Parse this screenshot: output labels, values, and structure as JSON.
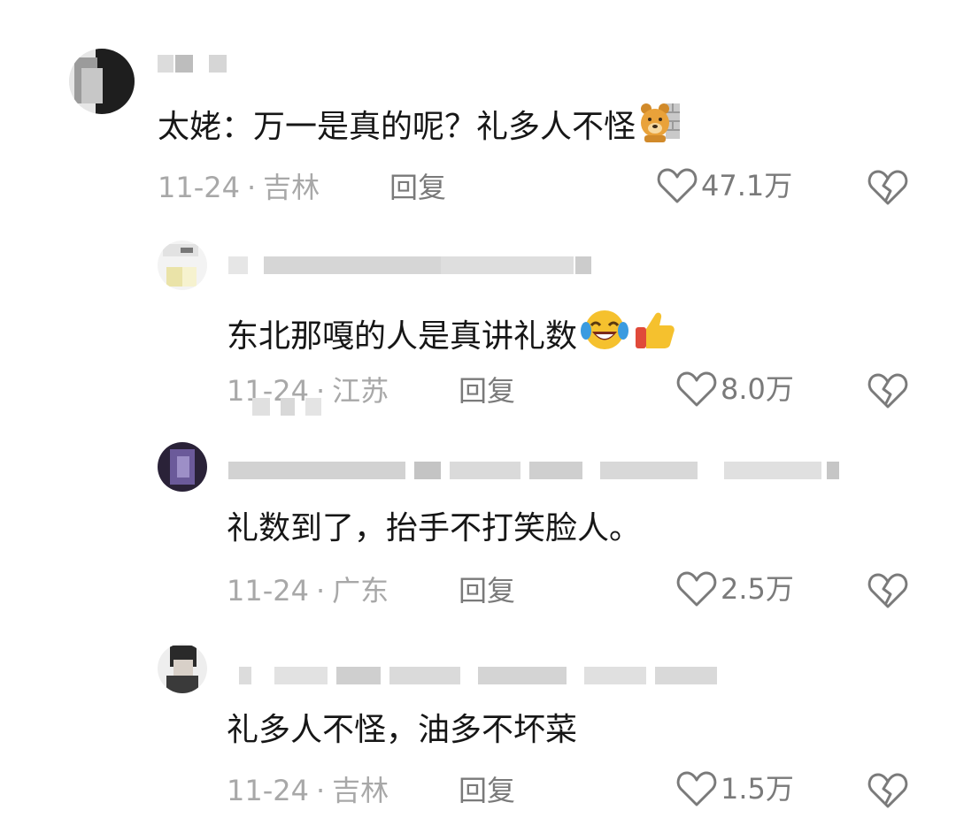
{
  "comments": [
    {
      "text": "太姥：万一是真的呢？礼多人不怪",
      "date": "11-24",
      "location": "吉林",
      "reply_label": "回复",
      "likes": "47.1万",
      "emoji_icon": "bear-emoji-icon"
    },
    {
      "text": "东北那嘎的人是真讲礼数",
      "date": "11-24",
      "location": "江苏",
      "reply_label": "回复",
      "likes": "8.0万",
      "emoji_icons": [
        "laughing-crying-emoji-icon",
        "thumbs-up-emoji-icon"
      ]
    },
    {
      "text": "礼数到了，抬手不打笑脸人。",
      "date": "11-24",
      "location": "广东",
      "reply_label": "回复",
      "likes": "2.5万"
    },
    {
      "text": "礼多人不怪，油多不坏菜",
      "date": "11-24",
      "location": "吉林",
      "reply_label": "回复",
      "likes": "1.5万"
    }
  ],
  "separator": "·",
  "icons": {
    "like": "heart-outline-icon",
    "dislike": "broken-heart-icon"
  },
  "colors": {
    "text": "#161616",
    "meta": "#a8a8a8",
    "action": "#7a7a7a"
  }
}
